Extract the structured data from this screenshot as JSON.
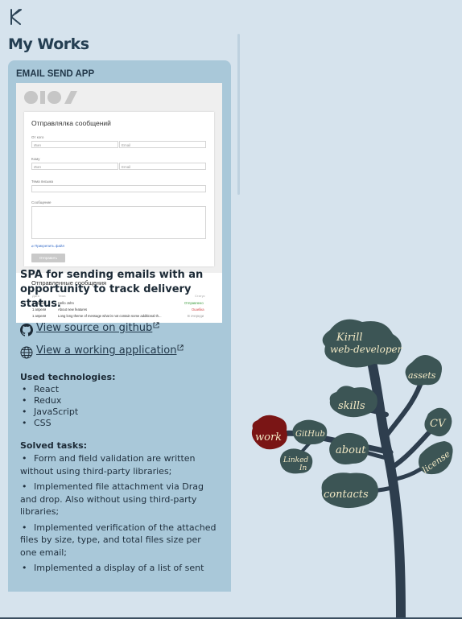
{
  "header": {
    "logo": "kb-logo",
    "page_title": "My Works"
  },
  "card": {
    "title": "EMAIL SEND APP",
    "preview": {
      "form_title": "Отправлялка сообщений",
      "from_label": "От кого",
      "to_label": "Кому",
      "subject_label": "Тема письма",
      "message_label": "Сообщение",
      "name_placeholder": "Имя",
      "email_placeholder": "Email",
      "attach_label": "Прикрепить файл",
      "send_label": "Отправить",
      "sent_title": "Отправленные сообщения",
      "col_date": "Дата",
      "col_subject": "Тема",
      "col_status": "Статус",
      "rows": [
        {
          "date": "1 апреля",
          "subject": "Hello John",
          "status": "Отправлено",
          "status_color": "#3a9a3a"
        },
        {
          "date": "1 апреля",
          "subject": "About new features",
          "status": "Ошибка",
          "status_color": "#d24a4a"
        },
        {
          "date": "1 апреля",
          "subject": "Long long theme of message what is not contain some additional th...",
          "status": "В очереди",
          "status_color": "#999999"
        }
      ]
    },
    "description": "SPA for sending emails with an opportunity to track delivery status.",
    "links": {
      "github": "View source on github",
      "app": "View a working application"
    },
    "technologies_heading": "Used technologies:",
    "technologies": [
      "React",
      "Redux",
      "JavaScript",
      "CSS"
    ],
    "tasks_heading": "Solved tasks:",
    "tasks": [
      "Form and field validation are written without using third-party libraries;",
      "Implemented file attachment via Drag and drop. Also without using third-party libraries;",
      "Implemented verification of the attached files by size, type, and total files size per one email;",
      "Implemented a display of a list of sent"
    ]
  },
  "tree": {
    "name_line1": "Kirill",
    "name_line2": "web-developer",
    "nodes": {
      "assets": "assets",
      "skills": "skills",
      "cv": "CV",
      "work": "work",
      "github": "GitHub",
      "about": "about",
      "linkedin_line1": "Linked",
      "linkedin_line2": "In",
      "license": "license",
      "contacts": "contacts"
    },
    "colors": {
      "leaf": "#3c5555",
      "active": "#7a1515",
      "branch": "#2e3e4e",
      "text": "#f1e8c4"
    }
  }
}
